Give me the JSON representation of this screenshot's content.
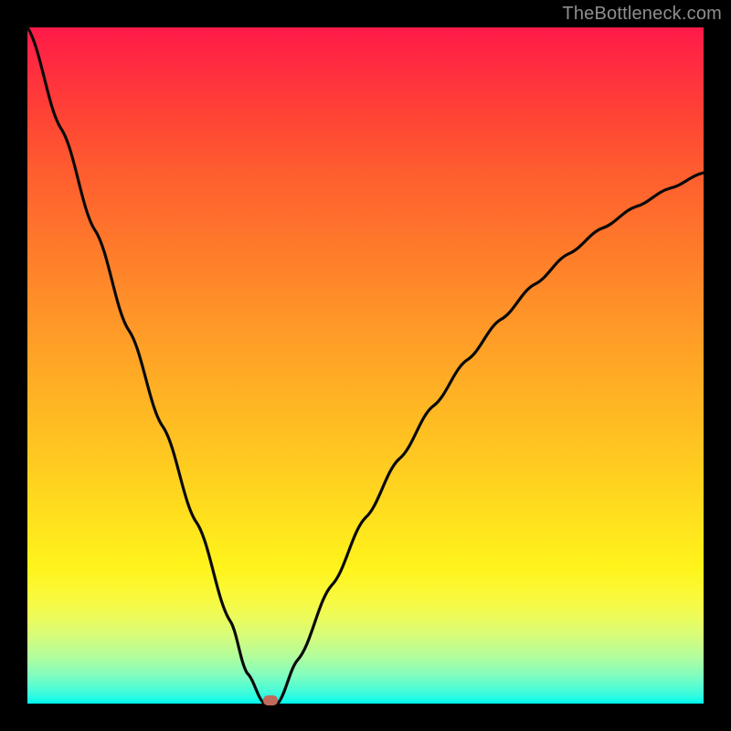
{
  "watermark": "TheBottleneck.com",
  "colors": {
    "frame_background": "#000000",
    "curve_stroke": "#0a0a0a",
    "marker_fill": "#c06a5b",
    "gradient_top": "#ff1a49",
    "gradient_bottom": "#00f9ef",
    "watermark_text": "#8e8e8e"
  },
  "chart_data": {
    "type": "line",
    "title": "",
    "xlabel": "",
    "ylabel": "",
    "xlim": [
      0,
      1
    ],
    "ylim": [
      0,
      1
    ],
    "series": [
      {
        "name": "curve",
        "x": [
          0.0,
          0.05,
          0.1,
          0.15,
          0.2,
          0.25,
          0.3,
          0.325,
          0.35,
          0.37,
          0.4,
          0.45,
          0.5,
          0.55,
          0.6,
          0.65,
          0.7,
          0.75,
          0.8,
          0.85,
          0.9,
          0.95,
          1.0
        ],
        "y": [
          1.0,
          0.85,
          0.7,
          0.552,
          0.41,
          0.268,
          0.122,
          0.045,
          0.0,
          0.0,
          0.065,
          0.175,
          0.275,
          0.362,
          0.44,
          0.508,
          0.568,
          0.62,
          0.665,
          0.703,
          0.735,
          0.762,
          0.785
        ]
      }
    ],
    "marker": {
      "x": 0.36,
      "y": 0.0
    }
  }
}
